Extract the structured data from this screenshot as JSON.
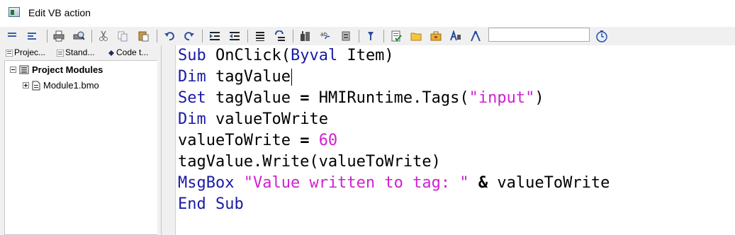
{
  "window": {
    "title": "Edit VB action",
    "icon": "vb-action-icon"
  },
  "toolbar": {
    "icons": [
      "indent-list-icon",
      "align-left-icon",
      "print-icon",
      "print-preview-icon",
      "cut-icon",
      "copy-icon",
      "paste-icon",
      "undo-icon",
      "redo-icon",
      "indent-icon",
      "outdent-icon",
      "comment-icon",
      "uncomment-icon",
      "build-icon",
      "find-replace-icon",
      "bookmark-icon",
      "help-icon",
      "syntax-check-icon",
      "folder-icon",
      "toolbox-icon",
      "font-icon",
      "compass-icon",
      "clock-icon"
    ],
    "search_value": ""
  },
  "tabs": [
    {
      "label": "Projec...",
      "icon": "project-icon"
    },
    {
      "label": "Stand...",
      "icon": "standard-icon"
    },
    {
      "label": "Code t...",
      "icon": "code-template-icon"
    }
  ],
  "tree": {
    "root": {
      "label": "Project Modules",
      "icon": "modules-icon"
    },
    "children": [
      {
        "label": "Module1.bmo",
        "icon": "module-file-icon"
      }
    ]
  },
  "editor": {
    "lines": [
      [
        {
          "t": "Sub",
          "c": "kw"
        },
        {
          "t": " OnClick(",
          "c": ""
        },
        {
          "t": "Byval",
          "c": "kw"
        },
        {
          "t": " Item)",
          "c": ""
        }
      ],
      [
        {
          "t": "Dim",
          "c": "kw"
        },
        {
          "t": " tagValue",
          "c": ""
        }
      ],
      [
        {
          "t": "Set",
          "c": "kw"
        },
        {
          "t": " tagValue ",
          "c": ""
        },
        {
          "t": "=",
          "c": "op"
        },
        {
          "t": " HMIRuntime.Tags(",
          "c": ""
        },
        {
          "t": "\"input\"",
          "c": "str"
        },
        {
          "t": ")",
          "c": ""
        }
      ],
      [
        {
          "t": "Dim",
          "c": "kw"
        },
        {
          "t": " valueToWrite",
          "c": ""
        }
      ],
      [
        {
          "t": "valueToWrite ",
          "c": ""
        },
        {
          "t": "=",
          "c": "op"
        },
        {
          "t": " ",
          "c": ""
        },
        {
          "t": "60",
          "c": "num"
        }
      ],
      [
        {
          "t": "tagValue.Write(valueToWrite)",
          "c": ""
        }
      ],
      [
        {
          "t": "MsgBox",
          "c": "kw"
        },
        {
          "t": " ",
          "c": ""
        },
        {
          "t": "\"Value written to tag: \"",
          "c": "str"
        },
        {
          "t": " ",
          "c": ""
        },
        {
          "t": "&",
          "c": "op"
        },
        {
          "t": " valueToWrite",
          "c": ""
        }
      ],
      [
        {
          "t": "End Sub",
          "c": "kw"
        }
      ]
    ],
    "caret_line": 1
  }
}
